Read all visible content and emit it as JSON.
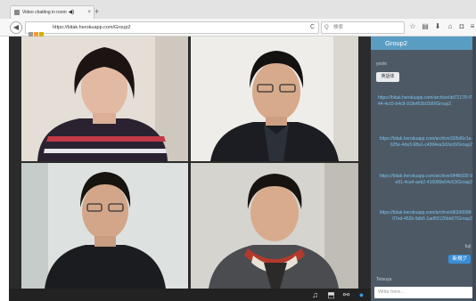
{
  "browser": {
    "tab_title": "Video chatting in room",
    "tab_close": "×",
    "new_tab": "+",
    "url": "https://bitak.herokuapp.com/Group2",
    "search_placeholder": "検索"
  },
  "chat": {
    "room_title": "Group2",
    "user1": "yoshi",
    "button_label": "英語体",
    "links": [
      "https://bitak.herokuapp.com/archive/dd72178-f744-4cc5-b4c8-919ef63b02d0/Group2",
      "https://bitak.herokuapp.com/archive/305d6e1a-625e-4de3-98a1-c4994ea3d2ec6/Group2",
      "https://bitak.herokuapp.com/archive/9f4fb930-9e81-4ca4-aeb2-416089e64c63/Group2",
      "https://bitak.herokuapp.com/archive/d62d9998-07ed-452b-9db5-1ad55126bb67/Group2"
    ],
    "user2": "fuji",
    "bubble": "新規グ",
    "user3": "Tetsuya",
    "input_placeholder": "Write here..."
  },
  "colors": {
    "chat_bg": "#4d5a66",
    "chat_header": "#5a9dc2",
    "link": "#7cc3ef",
    "bubble": "#3a8ed6"
  }
}
